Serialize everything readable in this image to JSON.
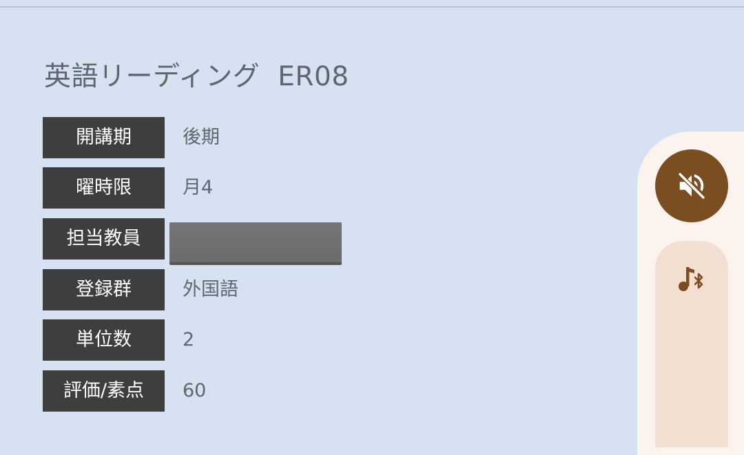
{
  "course": {
    "name": "英語リーディング",
    "code": "ER08"
  },
  "details": [
    {
      "label": "開講期",
      "value": "後期"
    },
    {
      "label": "曜時限",
      "value": "月4"
    },
    {
      "label": "担当教員",
      "value": ""
    },
    {
      "label": "登録群",
      "value": "外国語"
    },
    {
      "label": "単位数",
      "value": "2"
    },
    {
      "label": "評価/素点",
      "value": "60"
    }
  ],
  "volume_panel": {
    "mute_icon": "volume-off-icon",
    "output_icon": "bluetooth-music-icon",
    "colors": {
      "panel_bg": "#fdf3ee",
      "mute_button": "#7b4e21",
      "track": "#f2dfd1",
      "icon": "#7b4e21"
    }
  }
}
